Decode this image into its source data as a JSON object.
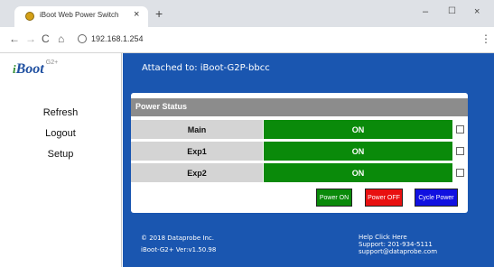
{
  "browser": {
    "tab_title": "iBoot Web Power Switch",
    "tab_close": "×",
    "new_tab": "+",
    "window_minimize": "–",
    "window_maximize": "☐",
    "window_close": "×",
    "address": "192.168.1.254",
    "nav_back": "←",
    "nav_forward": "→",
    "nav_reload": "C",
    "nav_home": "⌂",
    "menu": "⋮"
  },
  "sidebar": {
    "logo_i": "i",
    "logo_boot": "Boot",
    "logo_sup": "G2+",
    "items": [
      {
        "label": "Refresh"
      },
      {
        "label": "Logout"
      },
      {
        "label": "Setup"
      }
    ]
  },
  "header": {
    "attached": "Attached to: iBoot-G2P-bbcc"
  },
  "power_status": {
    "title": "Power Status",
    "outlets": [
      {
        "name": "Main",
        "state": "ON",
        "checked": false
      },
      {
        "name": "Exp1",
        "state": "ON",
        "checked": false
      },
      {
        "name": "Exp2",
        "state": "ON",
        "checked": false
      }
    ],
    "buttons": {
      "power_on": "Power ON",
      "power_off": "Power OFF",
      "cycle_power": "Cycle Power"
    }
  },
  "footer": {
    "copyright": "© 2018 Dataprobe Inc.",
    "version": "iBoot-G2+ Ver:v1.50.98",
    "help": "Help Click Here",
    "support_phone": "Support: 201-934-5111",
    "support_email": "support@dataprobe.com"
  },
  "colors": {
    "main_bg": "#1a56b0",
    "on_green": "#0a8a0a",
    "off_red": "#e81010",
    "cycle_blue": "#1010e0"
  }
}
